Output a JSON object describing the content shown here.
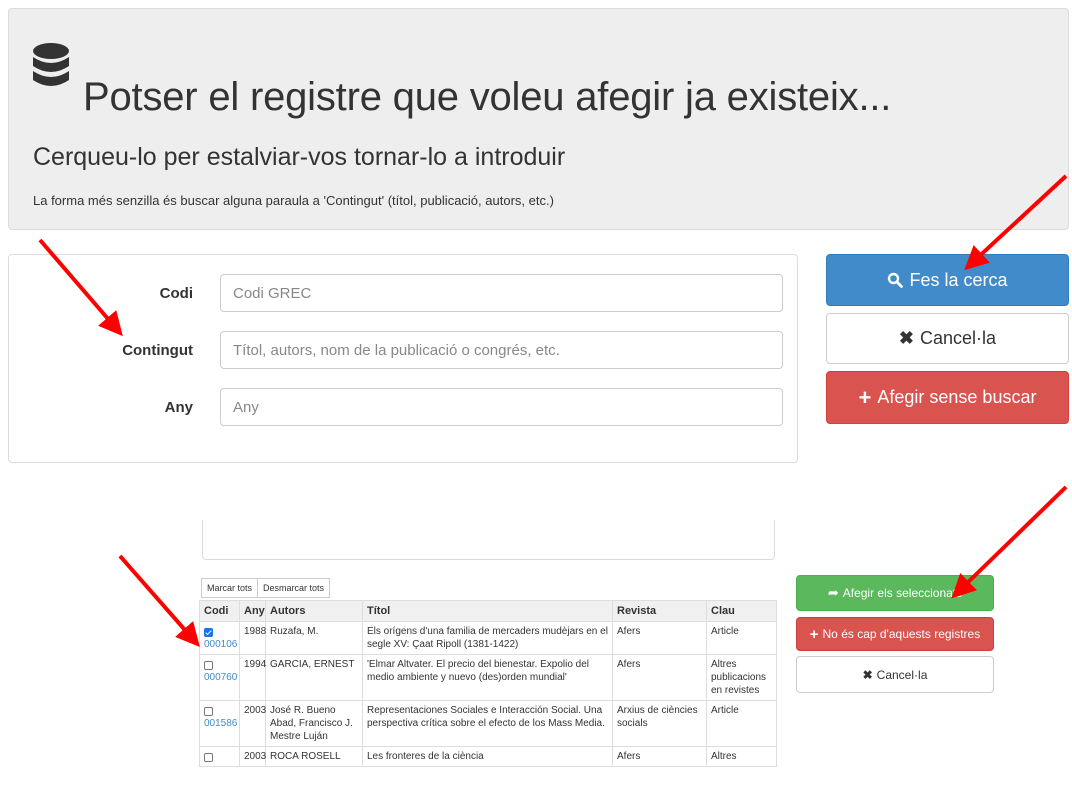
{
  "header": {
    "title": "Potser el registre que voleu afegir ja existeix...",
    "subtitle": "Cerqueu-lo per estalviar-vos tornar-lo a introduir",
    "hint": "La forma més senzilla és buscar alguna paraula a 'Contingut' (títol, publicació, autors, etc.)",
    "icon": "database-icon"
  },
  "form": {
    "codi": {
      "label": "Codi",
      "placeholder": "Codi GREC",
      "value": ""
    },
    "contingut": {
      "label": "Contingut",
      "placeholder": "Títol, autors, nom de la publicació o congrés, etc.",
      "value": ""
    },
    "any": {
      "label": "Any",
      "placeholder": "Any",
      "value": ""
    }
  },
  "actions": {
    "search": "Fes la cerca",
    "cancel": "Cancel·la",
    "add_without_search": "Afegir sense buscar"
  },
  "results": {
    "mark_all": "Marcar tots",
    "unmark_all": "Desmarcar tots",
    "columns": [
      "Codi",
      "Any",
      "Autors",
      "Títol",
      "Revista",
      "Clau"
    ],
    "rows": [
      {
        "checked": true,
        "codi": "000106",
        "any": "1988",
        "autors": "Ruzafa, M.",
        "titol": "Els orígens d'una familia de mercaders mudèjars en el segle XV: Çaat Ripoll (1381-1422)",
        "revista": "Afers",
        "clau": "Article"
      },
      {
        "checked": false,
        "codi": "000760",
        "any": "1994",
        "autors": "GARCIA, ERNEST",
        "titol": "'Elmar Altvater. El precio del bienestar. Expolio del medio ambiente y nuevo (des)orden mundial'",
        "revista": "Afers",
        "clau": "Altres publicacions en revistes"
      },
      {
        "checked": false,
        "codi": "001586",
        "any": "2003",
        "autors": "José R. Bueno Abad, Francisco J. Mestre Luján",
        "titol": "Representaciones Sociales e Interacción Social. Una perspectiva crítica sobre el efecto de los Mass Media.",
        "revista": "Arxius de ciències socials",
        "clau": "Article"
      },
      {
        "checked": false,
        "codi": "",
        "any": "2003",
        "autors": "ROCA ROSELL",
        "titol": "Les fronteres de la ciència",
        "revista": "Afers",
        "clau": "Altres"
      }
    ]
  },
  "result_actions": {
    "add_selected": "Afegir els seleccionats",
    "none_of_these": "No és cap d'aquests registres",
    "cancel": "Cancel·la"
  },
  "colors": {
    "primary": "#428bca",
    "danger": "#d9534f",
    "success": "#5cb85c",
    "annotation_arrow": "#ff0000"
  }
}
